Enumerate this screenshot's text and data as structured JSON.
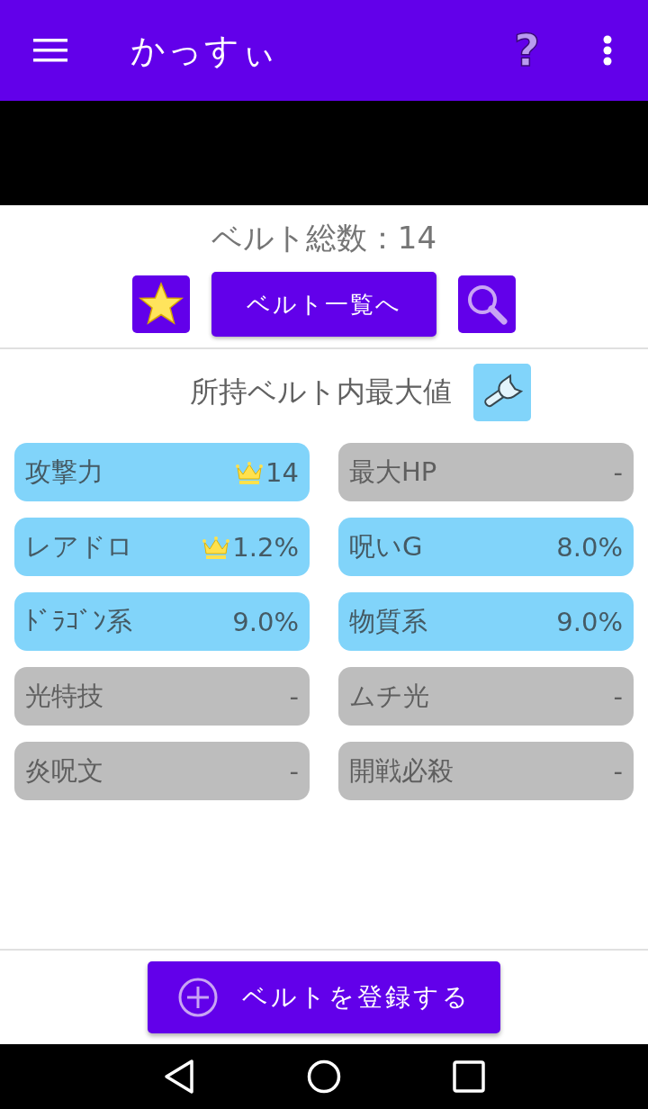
{
  "app_bar": {
    "title": "かっすぃ",
    "help": "?"
  },
  "summary": {
    "total": "ベルト総数：14",
    "list_button": "ベルト一覧へ"
  },
  "max_section": {
    "title": "所持ベルト内最大値"
  },
  "stats": [
    {
      "name": "攻撃力",
      "value": "14",
      "crowned": true,
      "highlighted": true
    },
    {
      "name": "最大HP",
      "value": "-",
      "crowned": false,
      "highlighted": false
    },
    {
      "name": "レアドロ",
      "value": "1.2%",
      "crowned": true,
      "highlighted": true
    },
    {
      "name": "呪いG",
      "value": "8.0%",
      "crowned": false,
      "highlighted": true
    },
    {
      "name": "ﾄﾞﾗｺﾞﾝ系",
      "value": "9.0%",
      "crowned": false,
      "highlighted": true
    },
    {
      "name": "物質系",
      "value": "9.0%",
      "crowned": false,
      "highlighted": true
    },
    {
      "name": "光特技",
      "value": "-",
      "crowned": false,
      "highlighted": false
    },
    {
      "name": "ムチ光",
      "value": "-",
      "crowned": false,
      "highlighted": false
    },
    {
      "name": "炎呪文",
      "value": "-",
      "crowned": false,
      "highlighted": false
    },
    {
      "name": "開戦必殺",
      "value": "-",
      "crowned": false,
      "highlighted": false
    }
  ],
  "register_button": "ベルトを登録する"
}
